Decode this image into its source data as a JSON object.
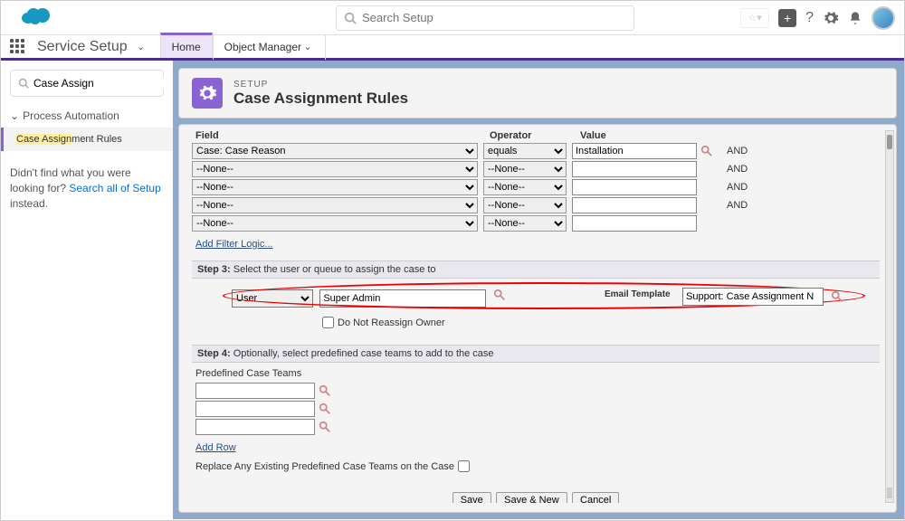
{
  "topbar": {
    "search_placeholder": "Search Setup",
    "fav": "☆▾"
  },
  "nav": {
    "brand": "Service Setup",
    "tabs": [
      {
        "label": "Home",
        "active": true
      },
      {
        "label": "Object Manager",
        "active": false
      }
    ]
  },
  "sidebar": {
    "search_value": "Case Assign",
    "section": "Process Automation",
    "item_hl": "Case Assign",
    "item_rest": "ment Rules",
    "help_1": "Didn't find what you were looking for? ",
    "help_link": "Search all of Setup",
    "help_2": " instead."
  },
  "header": {
    "sub": "SETUP",
    "title": "Case Assignment Rules"
  },
  "criteria": {
    "labels": {
      "field": "Field",
      "operator": "Operator",
      "value": "Value",
      "and": "AND"
    },
    "filter_logic": "Add Filter Logic...",
    "rows": [
      {
        "field": "Case: Case Reason",
        "op": "equals",
        "val": "Installation",
        "and": true
      },
      {
        "field": "--None--",
        "op": "--None--",
        "val": "",
        "and": true
      },
      {
        "field": "--None--",
        "op": "--None--",
        "val": "",
        "and": true
      },
      {
        "field": "--None--",
        "op": "--None--",
        "val": "",
        "and": true
      },
      {
        "field": "--None--",
        "op": "--None--",
        "val": "",
        "and": false
      }
    ]
  },
  "step3": {
    "bar_b": "Step 3:",
    "bar_t": " Select the user or queue to assign the case to",
    "type": "User",
    "assignee": "Super Admin",
    "email_label": "Email Template",
    "email_value": "Support: Case Assignment N",
    "chk_label": "Do Not Reassign Owner"
  },
  "step4": {
    "bar_b": "Step 4:",
    "bar_t": " Optionally, select predefined case teams to add to the case",
    "pd_title": "Predefined Case Teams",
    "add_row": "Add Row",
    "replace": "Replace Any Existing Predefined Case Teams on the Case"
  },
  "buttons": {
    "save": "Save",
    "savenew": "Save & New",
    "cancel": "Cancel"
  }
}
